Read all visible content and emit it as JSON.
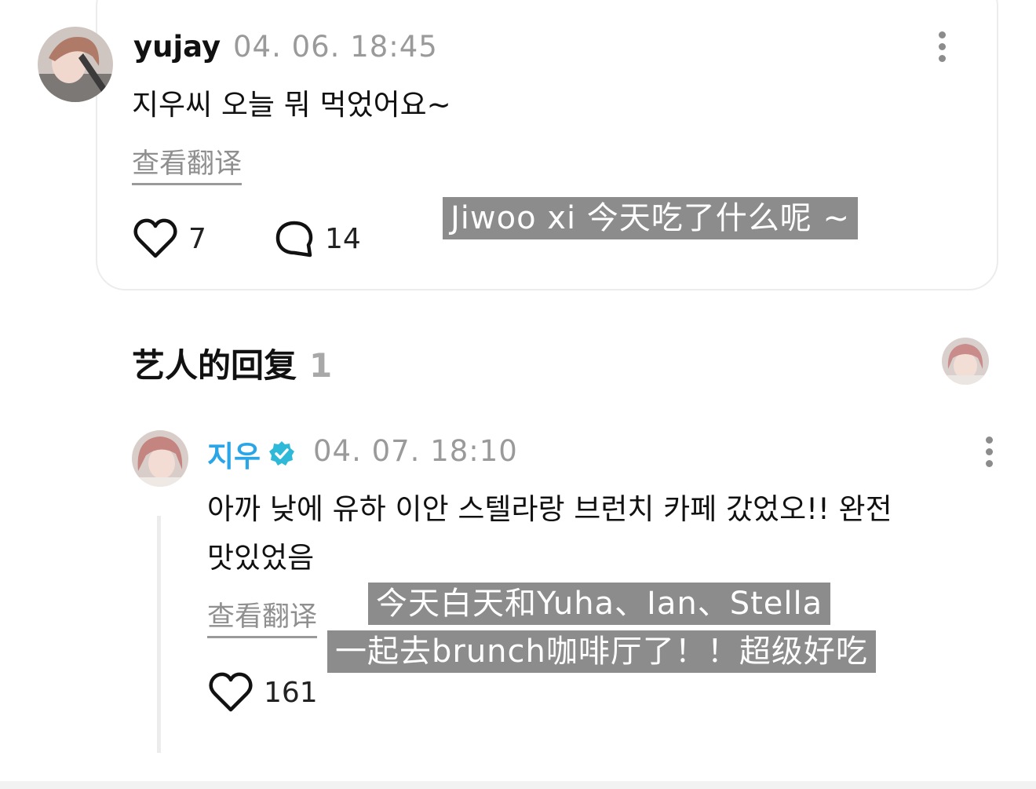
{
  "comment": {
    "username": "yujay",
    "timestamp": "04. 06. 18:45",
    "text": "지우씨 오늘 뭐 먹었어요~",
    "translate_label": "查看翻译",
    "likes": "7",
    "replies": "14",
    "subtitle": "Jiwoo xi 今天吃了什么呢 ~"
  },
  "artist_section": {
    "title": "艺人的回复",
    "count": "1"
  },
  "reply": {
    "username": "지우",
    "timestamp": "04. 07. 18:10",
    "text_line1": "아까 낮에 유하 이안 스텔라랑 브런치 카페 갔었오!! 완전",
    "text_line2": "맛있었음",
    "translate_label": "查看翻译",
    "likes": "161",
    "subtitle_line1": "今天白天和Yuha、Ian、Stella",
    "subtitle_line2": "一起去brunch咖啡厅了！！超级好吃"
  },
  "icons": {
    "like": "heart-outline-icon",
    "comment": "speech-bubble-icon",
    "more": "vertical-ellipsis-icon",
    "verified": "verified-badge-icon"
  },
  "colors": {
    "artist_name": "#2aa5e8",
    "verified_badge": "#2fb9d9",
    "subtitle_bg": "#8c8c8c",
    "timestamp": "#9a9a9a"
  }
}
